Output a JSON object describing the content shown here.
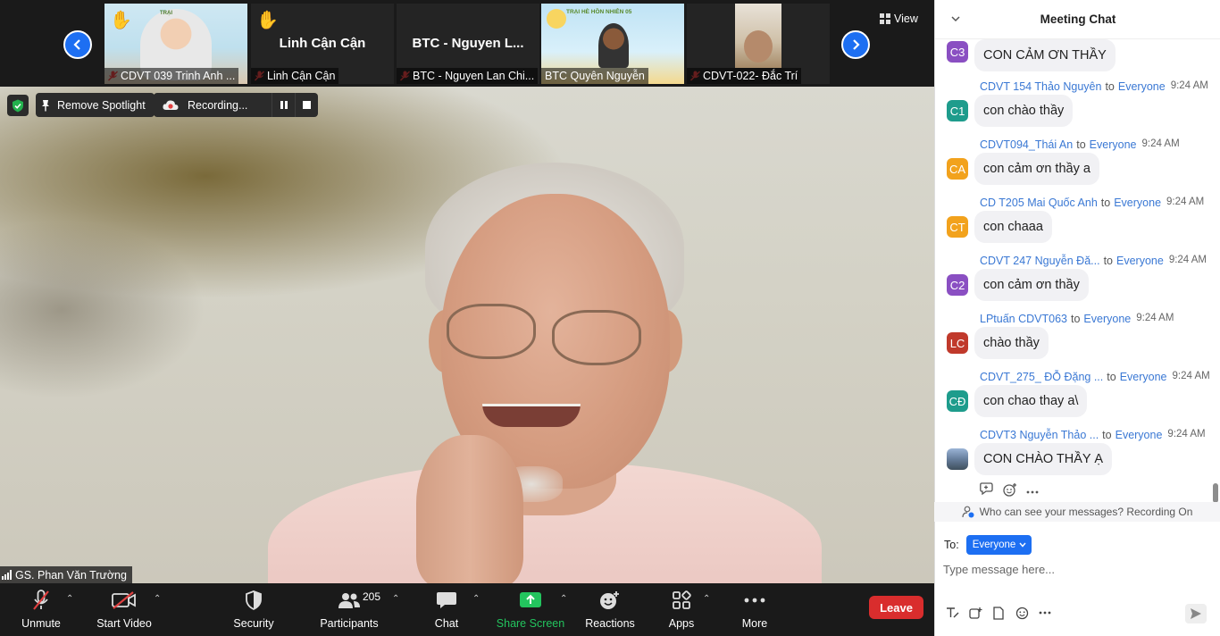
{
  "strip": {
    "tiles": [
      {
        "name": "CDVT 039 Trinh Anh ...",
        "hand": "✋",
        "big_name": ""
      },
      {
        "name": "Linh Cận Cận",
        "hand": "✋",
        "big_name": "Linh Cận Cận"
      },
      {
        "name": "BTC - Nguyen Lan Chi...",
        "hand": "",
        "big_name": "BTC - Nguyen L..."
      },
      {
        "name": "BTC Quyên Nguyễn",
        "hand": "",
        "big_name": "",
        "banner": "TRẠI HÈ HỒN NHIÊN 05"
      },
      {
        "name": "CDVT-022- Đắc Trí",
        "hand": "",
        "big_name": ""
      }
    ],
    "view_label": "View",
    "tile1_banner": "TRẠI"
  },
  "main": {
    "remove_spotlight": "Remove Spotlight",
    "recording": "Recording...",
    "speaker": "GS. Phan Văn Trường"
  },
  "toolbar": {
    "unmute": "Unmute",
    "start_video": "Start Video",
    "security": "Security",
    "participants": "Participants",
    "participants_count": "205",
    "chat": "Chat",
    "share_screen": "Share Screen",
    "reactions": "Reactions",
    "apps": "Apps",
    "more": "More",
    "leave": "Leave",
    "share_color": "#23c45e",
    "leave_color": "#d92d2d"
  },
  "chat": {
    "title": "Meeting Chat",
    "messages": [
      {
        "sender": "",
        "to": "",
        "recipient": "",
        "time": "",
        "initials": "C3",
        "color": "#8a4fc2",
        "text": "CON CẢM ƠN THẦY"
      },
      {
        "sender": "CDVT 154 Thảo Nguyên",
        "to": "to",
        "recipient": "Everyone",
        "time": "9:24 AM",
        "initials": "C1",
        "color": "#1e9c8c",
        "text": "con chào thầy"
      },
      {
        "sender": "CDVT094_Thái An",
        "to": "to",
        "recipient": "Everyone",
        "time": "9:24 AM",
        "initials": "CA",
        "color": "#f2a21c",
        "text": "con cảm ơn thầy a"
      },
      {
        "sender": "CD T205 Mai Quốc Anh",
        "to": "to",
        "recipient": "Everyone",
        "time": "9:24 AM",
        "initials": "CT",
        "color": "#f2a21c",
        "text": "con chaaa"
      },
      {
        "sender": "CDVT 247 Nguyễn Đă...",
        "to": "to",
        "recipient": "Everyone",
        "time": "9:24 AM",
        "initials": "C2",
        "color": "#8a4fc2",
        "text": "con cảm ơn thầy"
      },
      {
        "sender": "LPtuấn CDVT063",
        "to": "to",
        "recipient": "Everyone",
        "time": "9:24 AM",
        "initials": "LC",
        "color": "#c0392b",
        "text": "chào thầy"
      },
      {
        "sender": "CDVT_275_ ĐỖ Đặng ...",
        "to": "to",
        "recipient": "Everyone",
        "time": "9:24 AM",
        "initials": "CĐ",
        "color": "#1e9c8c",
        "text": "con chao thay a\\"
      },
      {
        "sender": "CDVT3 Nguyễn Thảo ...",
        "to": "to",
        "recipient": "Everyone",
        "time": "9:24 AM",
        "initials": "",
        "color": "#667e9c",
        "text": "CON CHÀO THẦY Ạ"
      }
    ],
    "privacy_note": "Who can see your messages? Recording On",
    "to_label": "To:",
    "to_value": "Everyone",
    "input_placeholder": "Type message here...",
    "accent_color": "#1d6ff2"
  }
}
